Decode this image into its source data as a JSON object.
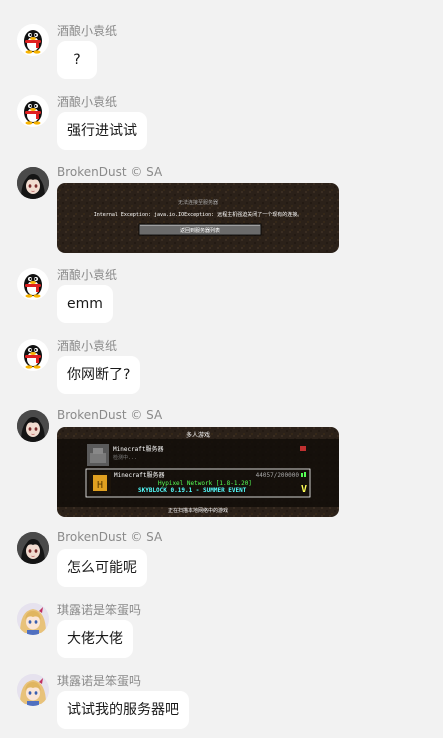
{
  "messages": [
    {
      "sender": "酒酿小袁纸",
      "type": "text",
      "text": "?",
      "avatar": "qq-penguin-avatar"
    },
    {
      "sender": "酒酿小袁纸",
      "type": "text",
      "text": "强行进试试",
      "avatar": "qq-penguin-avatar"
    },
    {
      "sender": "BrokenDust © SA",
      "type": "image",
      "avatar": "anime-girl-avatar",
      "image": {
        "title": "无法连接至服务器",
        "body": "Internal Exception: java.io.IOException: 远程主机强迫关闭了一个现有的连接。",
        "button": "返回到服务器列表"
      }
    },
    {
      "sender": "酒酿小袁纸",
      "type": "text",
      "text": "emm",
      "avatar": "qq-penguin-avatar"
    },
    {
      "sender": "酒酿小袁纸",
      "type": "text",
      "text": "你网断了?",
      "avatar": "qq-penguin-avatar"
    },
    {
      "sender": "BrokenDust © SA",
      "type": "image",
      "avatar": "anime-girl-avatar",
      "image": {
        "title": "多人游戏",
        "server1_name": "Minecraft服务器",
        "server1_status": "检测中...",
        "server2_name": "Minecraft服务器",
        "server2_players": "44057/200000",
        "server2_motd1": "Hypixel Network [1.8-1.20]",
        "server2_motd2": "SKYBLOCK 0.19.1 - SUMMER EVENT",
        "server2_badge": "V",
        "footer": "正在扫描本地网络中的游戏"
      }
    },
    {
      "sender": "BrokenDust © SA",
      "type": "text",
      "text": "怎么可能呢",
      "avatar": "anime-girl-avatar"
    },
    {
      "sender": "琪露诺是笨蛋吗",
      "type": "text",
      "text": "大佬大佬",
      "avatar": "anime-blonde-avatar"
    },
    {
      "sender": "琪露诺是笨蛋吗",
      "type": "text",
      "text": "试试我的服务器吧",
      "avatar": "anime-blonde-avatar"
    }
  ],
  "colors": {
    "background": "#f2f2f2",
    "bubble": "#ffffff",
    "name": "#8a8a8a",
    "mc_dirt": "#2b2119",
    "mc_green": "#55ff55",
    "mc_yellow": "#ffff55",
    "mc_aqua": "#55ffff"
  }
}
